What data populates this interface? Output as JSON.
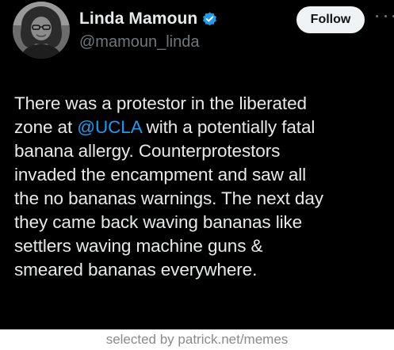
{
  "author": {
    "display_name": "Linda Mamoun",
    "handle": "@mamoun_linda",
    "verified_icon": "verified-badge-icon",
    "avatar_icon": "avatar-photo"
  },
  "actions": {
    "follow_label": "Follow",
    "more_icon": "more-options-icon"
  },
  "tweet": {
    "lines": [
      {
        "before": "There was a protestor in the liberated",
        "mention": "",
        "after": ""
      },
      {
        "before": "zone at ",
        "mention": "@UCLA",
        "after": " with a potentially fatal"
      },
      {
        "before": "banana allergy. Counterprotestors",
        "mention": "",
        "after": ""
      },
      {
        "before": "invaded the encampment and saw all",
        "mention": "",
        "after": ""
      },
      {
        "before": "the no bananas warnings. The next day",
        "mention": "",
        "after": ""
      },
      {
        "before": "they came back waving bananas like",
        "mention": "",
        "after": ""
      },
      {
        "before": "settlers waving machine guns &",
        "mention": "",
        "after": ""
      },
      {
        "before": "smeared bananas everywhere.",
        "mention": "",
        "after": ""
      }
    ]
  },
  "footer": {
    "watermark": "selected by patrick.net/memes"
  },
  "colors": {
    "background": "#000000",
    "text": "#e7e9ea",
    "secondary_text": "#71767b",
    "mention": "#1d9bf0",
    "verified": "#1d9bf0",
    "follow_bg": "#eff3f4"
  }
}
